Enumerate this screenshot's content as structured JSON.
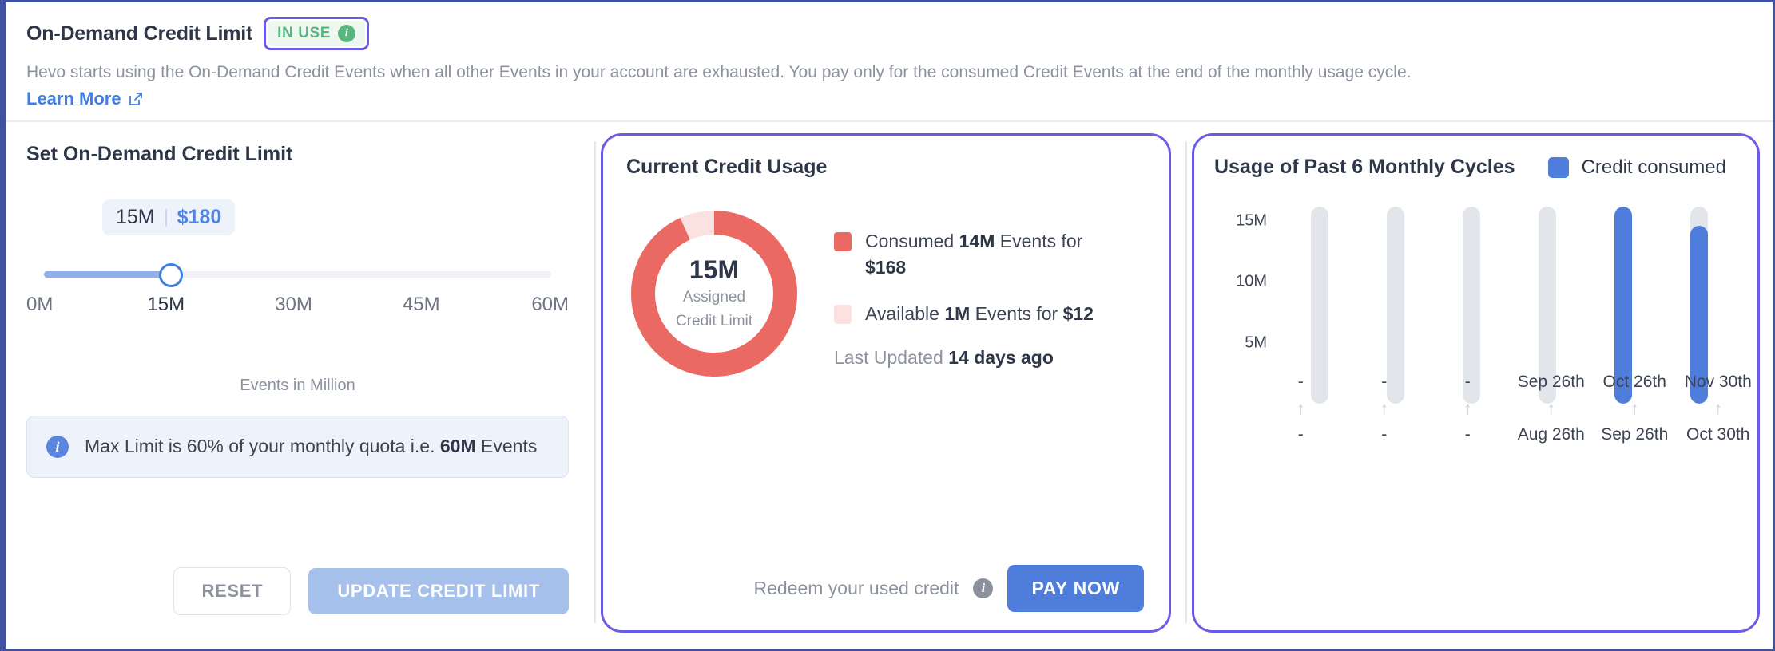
{
  "header": {
    "title": "On-Demand Credit Limit",
    "badge_label": "IN USE",
    "badge_info_icon": "info-icon",
    "description": "Hevo starts using the On-Demand Credit Events when all other Events in your account are exhausted. You pay only for the consumed Credit Events at the end of the monthly usage cycle.",
    "learn_more_label": "Learn More",
    "learn_more_icon": "external-link-icon"
  },
  "left_panel": {
    "title": "Set On-Demand Credit Limit",
    "tooltip": {
      "value": "15M",
      "price": "$180"
    },
    "slider": {
      "current_value": "15M",
      "current_percent": 25,
      "ticks": [
        "0M",
        "15M",
        "30M",
        "45M",
        "60M"
      ],
      "selected_tick_index": 1,
      "min_label": "0M",
      "max_label": "60M"
    },
    "axis_caption": "Events in Million",
    "info_note": {
      "icon": "info-icon",
      "text_before": "Max Limit is 60% of your monthly quota i.e. ",
      "text_bold": "60M",
      "text_after": " Events"
    },
    "reset_label": "RESET",
    "update_label": "UPDATE CREDIT LIMIT"
  },
  "middle_panel": {
    "title": "Current Credit Usage",
    "donut": {
      "center_value": "15M",
      "center_line1": "Assigned",
      "center_line2": "Credit Limit",
      "consumed_percent": 93.3,
      "available_percent": 6.7,
      "consumed_color": "#ea6a63",
      "available_color": "#fbe2e0"
    },
    "legend": [
      {
        "swatch_color": "#ea6a63",
        "prefix": "Consumed ",
        "bold1": "14M",
        "middle": " Events for ",
        "bold2": "$168",
        "suffix": ""
      },
      {
        "swatch_color": "#fbe2e0",
        "prefix": "Available ",
        "bold1": "1M",
        "middle": " Events for ",
        "bold2": "$12",
        "suffix": ""
      }
    ],
    "last_updated_label": "Last Updated ",
    "last_updated_value": "14 days ago",
    "redeem_text": "Redeem your used credit",
    "redeem_info_icon": "info-icon",
    "pay_now_label": "PAY NOW"
  },
  "right_panel": {
    "title": "Usage of Past 6 Monthly Cycles",
    "legend_label": "Credit consumed",
    "legend_color": "#4e7ddb"
  },
  "chart_data": {
    "type": "bar",
    "title": "Usage of Past 6 Monthly Cycles",
    "xlabel": "",
    "ylabel": "",
    "ylim": [
      0,
      17
    ],
    "yticks": [
      5,
      10,
      15
    ],
    "ytick_labels": [
      "5M",
      "10M",
      "15M"
    ],
    "grid": false,
    "legend_position": "top-right",
    "series": [
      {
        "name": "Credit consumed",
        "values": [
          0,
          0,
          0,
          0,
          16.2,
          14.6
        ],
        "color": "#4e7ddb"
      }
    ],
    "track_max": 16.2,
    "track_color": "#e2e5ea",
    "categories": [
      "-",
      "-",
      "-",
      "Sep 26th",
      "Oct 26th",
      "Nov 30th"
    ],
    "cycles": [
      {
        "end": "-",
        "arrow": "↑",
        "start": "-"
      },
      {
        "end": "-",
        "arrow": "↑",
        "start": "-"
      },
      {
        "end": "-",
        "arrow": "↑",
        "start": "-"
      },
      {
        "end": "Sep 26th",
        "arrow": "↑",
        "start": "Aug 26th"
      },
      {
        "end": "Oct 26th",
        "arrow": "↑",
        "start": "Sep 26th"
      },
      {
        "end": "Nov 30th",
        "arrow": "↑",
        "start": "Oct 30th"
      }
    ]
  }
}
